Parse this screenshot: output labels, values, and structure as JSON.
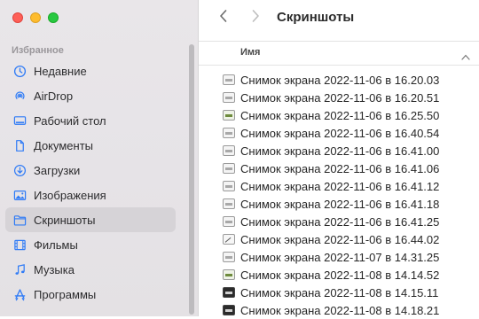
{
  "sidebar": {
    "section_title": "Избранное",
    "items": [
      {
        "label": "Недавние",
        "icon": "clock-icon"
      },
      {
        "label": "AirDrop",
        "icon": "airdrop-icon"
      },
      {
        "label": "Рабочий стол",
        "icon": "desktop-icon"
      },
      {
        "label": "Документы",
        "icon": "document-icon"
      },
      {
        "label": "Загрузки",
        "icon": "download-icon"
      },
      {
        "label": "Изображения",
        "icon": "photo-icon"
      },
      {
        "label": "Скриншоты",
        "icon": "folder-icon",
        "selected": true
      },
      {
        "label": "Фильмы",
        "icon": "film-icon"
      },
      {
        "label": "Музыка",
        "icon": "music-icon"
      },
      {
        "label": "Программы",
        "icon": "applications-icon"
      }
    ]
  },
  "toolbar": {
    "title": "Скриншоты"
  },
  "list": {
    "column_name": "Имя",
    "files": [
      {
        "name": "Снимок экрана 2022-11-06 в 16.20.03",
        "thumb": "light"
      },
      {
        "name": "Снимок экрана 2022-11-06 в 16.20.51",
        "thumb": "light"
      },
      {
        "name": "Снимок экрана 2022-11-06 в 16.25.50",
        "thumb": "green"
      },
      {
        "name": "Снимок экрана 2022-11-06 в 16.40.54",
        "thumb": "light"
      },
      {
        "name": "Снимок экрана 2022-11-06 в 16.41.00",
        "thumb": "light"
      },
      {
        "name": "Снимок экрана 2022-11-06 в 16.41.06",
        "thumb": "light"
      },
      {
        "name": "Снимок экрана 2022-11-06 в 16.41.12",
        "thumb": "light"
      },
      {
        "name": "Снимок экрана 2022-11-06 в 16.41.18",
        "thumb": "light"
      },
      {
        "name": "Снимок экрана 2022-11-06 в 16.41.25",
        "thumb": "light"
      },
      {
        "name": "Снимок экрана 2022-11-06 в 16.44.02",
        "thumb": "pencil"
      },
      {
        "name": "Снимок экрана 2022-11-07 в 14.31.25",
        "thumb": "light"
      },
      {
        "name": "Снимок экрана 2022-11-08 в 14.14.52",
        "thumb": "green"
      },
      {
        "name": "Снимок экрана 2022-11-08 в 14.15.11",
        "thumb": "dark"
      },
      {
        "name": "Снимок экрана 2022-11-08 в 14.18.21",
        "thumb": "dark"
      }
    ]
  },
  "colors": {
    "accent": "#2f7bf6",
    "sidebar_bg": "#e7e4e8",
    "selected_bg": "#d6d3d7"
  }
}
